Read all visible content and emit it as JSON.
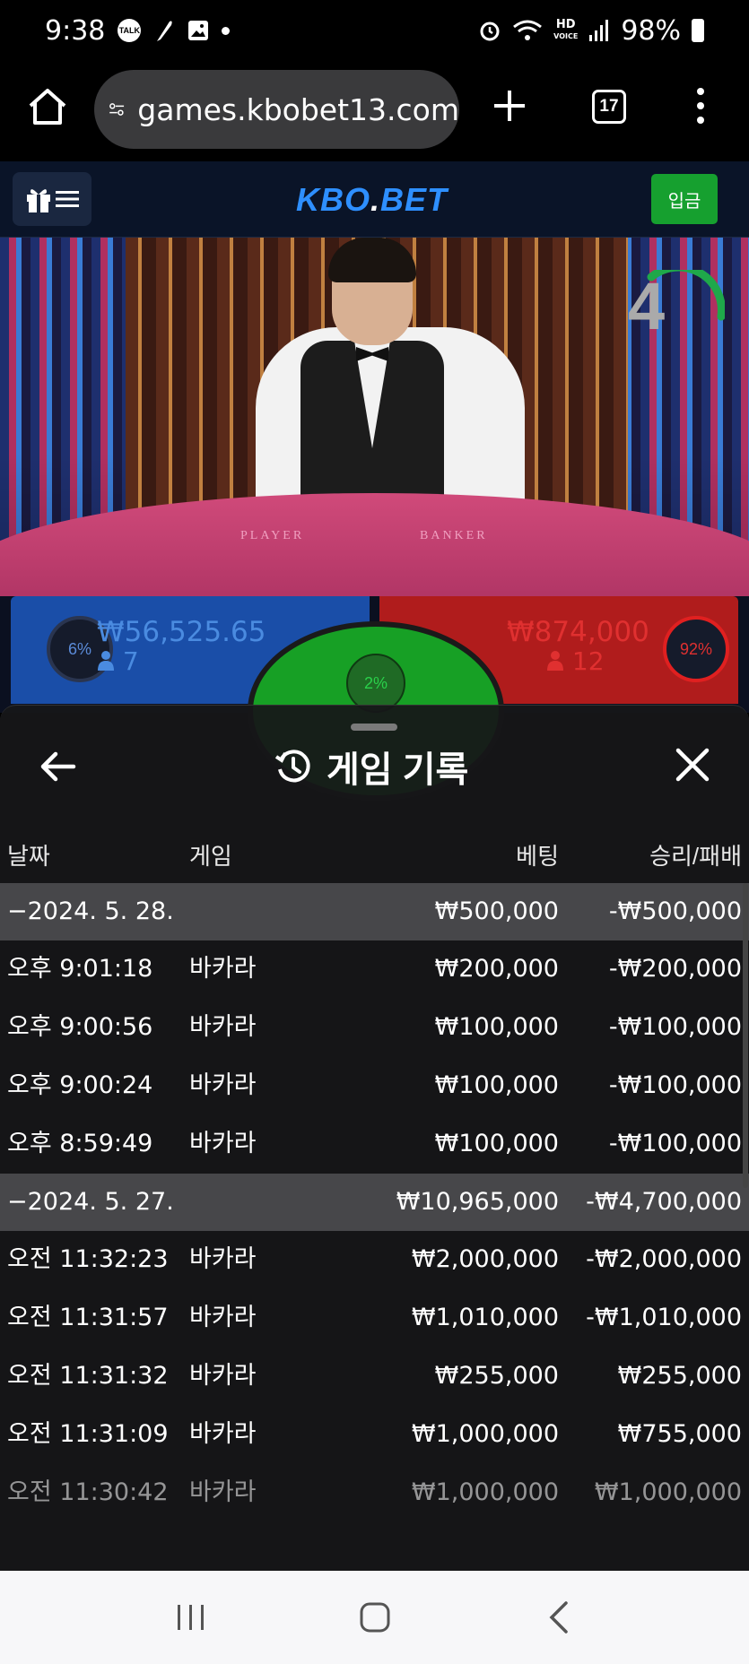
{
  "status_bar": {
    "time": "9:38",
    "hd_label": "HD",
    "voice_label": "VOICE",
    "battery_text": "98%",
    "talk_label": "TALK"
  },
  "browser": {
    "url": "games.kbobet13.com",
    "tab_count": "17"
  },
  "site": {
    "logo_main": "KBO",
    "logo_dot": ".",
    "logo_tail": "BET",
    "deposit_label": "입금"
  },
  "video": {
    "countdown": "4",
    "player_label": "PLAYER",
    "banker_label": "BANKER"
  },
  "betting": {
    "player_pct": "6%",
    "player_amount": "₩56,525.65",
    "player_count": "7",
    "tie_pct": "2%",
    "banker_amount": "₩874,000",
    "banker_count": "12",
    "banker_pct": "92%"
  },
  "history": {
    "title": "게임 기록",
    "columns": {
      "date": "날짜",
      "game": "게임",
      "bet": "베팅",
      "result": "승리/패배"
    },
    "rows": [
      {
        "type": "date",
        "date": "−2024. 5. 28.",
        "game": "",
        "bet": "₩500,000",
        "result": "-₩500,000"
      },
      {
        "type": "entry",
        "date": "오후 9:01:18",
        "game": "바카라",
        "bet": "₩200,000",
        "result": "-₩200,000"
      },
      {
        "type": "entry",
        "date": "오후 9:00:56",
        "game": "바카라",
        "bet": "₩100,000",
        "result": "-₩100,000"
      },
      {
        "type": "entry",
        "date": "오후 9:00:24",
        "game": "바카라",
        "bet": "₩100,000",
        "result": "-₩100,000"
      },
      {
        "type": "entry",
        "date": "오후 8:59:49",
        "game": "바카라",
        "bet": "₩100,000",
        "result": "-₩100,000"
      },
      {
        "type": "date",
        "date": "−2024. 5. 27.",
        "game": "",
        "bet": "₩10,965,000",
        "result": "-₩4,700,000"
      },
      {
        "type": "entry",
        "date": "오전 11:32:23",
        "game": "바카라",
        "bet": "₩2,000,000",
        "result": "-₩2,000,000"
      },
      {
        "type": "entry",
        "date": "오전 11:31:57",
        "game": "바카라",
        "bet": "₩1,010,000",
        "result": "-₩1,010,000"
      },
      {
        "type": "entry",
        "date": "오전 11:31:32",
        "game": "바카라",
        "bet": "₩255,000",
        "result": "₩255,000"
      },
      {
        "type": "entry",
        "date": "오전 11:31:09",
        "game": "바카라",
        "bet": "₩1,000,000",
        "result": "₩755,000"
      },
      {
        "type": "entry",
        "date": "오전 11:30:42",
        "game": "바카라",
        "bet": "₩1,000,000",
        "result": "₩1,000,000"
      }
    ]
  },
  "colors": {
    "player_blue": "#1a4ea8",
    "banker_red": "#b01c1c",
    "tie_green": "#17a025",
    "deposit_green": "#16a02f",
    "logo_blue": "#2e8fff"
  },
  "icons": {
    "home": "home-icon",
    "site_settings": "tune-icon",
    "new_tab": "plus-icon",
    "overflow": "more-vert-icon",
    "gift": "gift-icon",
    "hamburger": "menu-icon",
    "history": "history-icon",
    "back": "arrow-left-icon",
    "close": "close-icon"
  }
}
